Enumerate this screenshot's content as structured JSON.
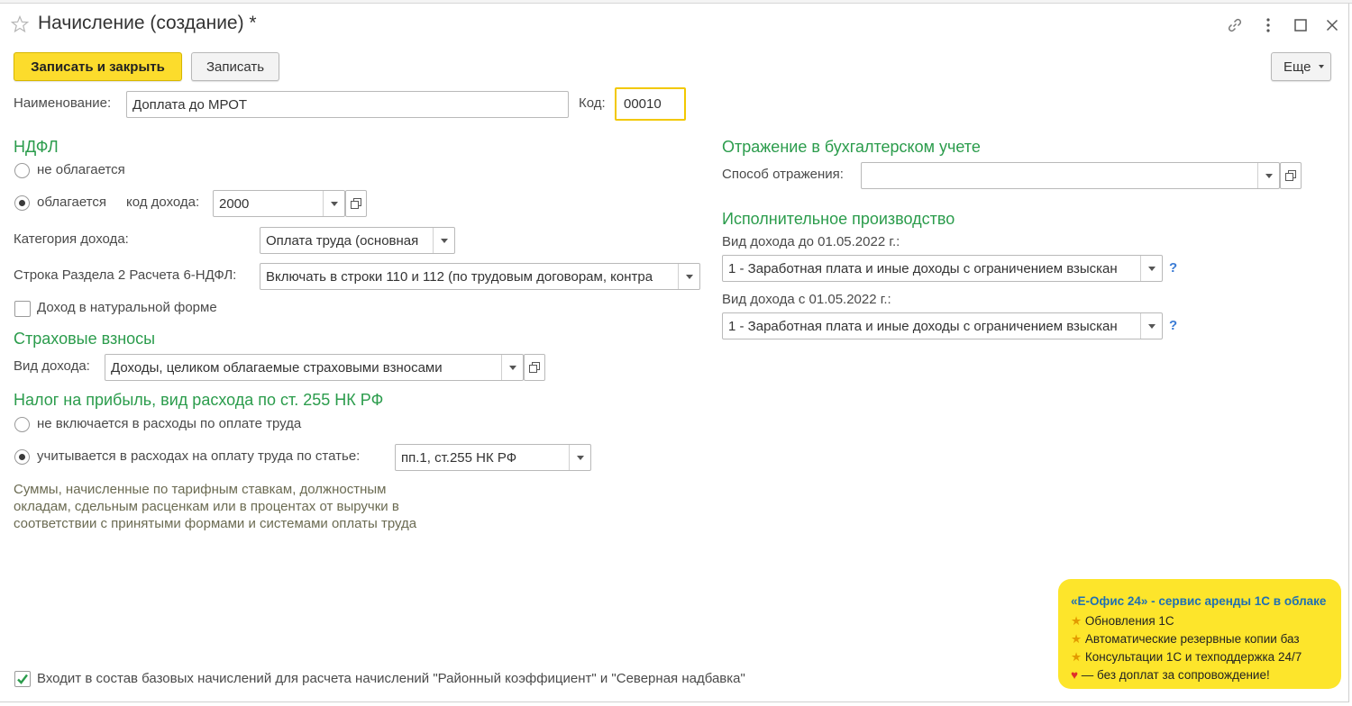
{
  "window": {
    "title": "Начисление (создание) *"
  },
  "toolbar": {
    "save_close_label": "Записать и закрыть",
    "save_label": "Записать",
    "more_label": "Еще"
  },
  "form": {
    "name_label": "Наименование:",
    "name_value": "Доплата до МРОТ",
    "code_label": "Код:",
    "code_value": "00010"
  },
  "ndfl": {
    "title": "НДФЛ",
    "not_taxed_label": "не облагается",
    "taxed_label": "облагается",
    "selected": "taxed",
    "income_code_label": "код дохода:",
    "income_code_value": "2000",
    "income_category_label": "Категория дохода:",
    "income_category_value": "Оплата труда (основная",
    "section2_label": "Строка Раздела 2 Расчета 6-НДФЛ:",
    "section2_value": "Включать в строки 110 и 112 (по трудовым договорам, контра",
    "natural_form_label": "Доход в натуральной форме",
    "natural_form_checked": false
  },
  "insurance": {
    "title": "Страховые взносы",
    "income_type_label": "Вид дохода:",
    "income_type_value": "Доходы, целиком облагаемые страховыми взносами"
  },
  "profit_tax": {
    "title": "Налог на прибыль, вид расхода по ст. 255 НК РФ",
    "not_included_label": "не включается в расходы по оплате труда",
    "included_label": "учитывается в расходах на оплату труда по статье:",
    "selected": "included",
    "article_value": "пп.1, ст.255 НК РФ",
    "hint_line1": "Суммы, начисленные по тарифным ставкам, должностным",
    "hint_line2": "окладам, сдельным расценкам или в процентах от выручки в",
    "hint_line3": "соответствии с принятыми формами и системами оплаты труда"
  },
  "accounting": {
    "title": "Отражение в бухгалтерском учете",
    "method_label": "Способ отражения:",
    "method_value": ""
  },
  "enforcement": {
    "title": "Исполнительное производство",
    "before_label": "Вид дохода до 01.05.2022 г.:",
    "before_value": "1 - Заработная плата и иные доходы с ограничением взыскан",
    "after_label": "Вид дохода с 01.05.2022 г.:",
    "after_value": "1 - Заработная плата и иные доходы с ограничением взыскан",
    "help_mark": "?"
  },
  "base_accruals": {
    "label": "Входит в состав базовых начислений для расчета начислений \"Районный коэффициент\" и \"Северная надбавка\"",
    "checked": true
  },
  "promo": {
    "headline": "«Е-Офис 24» - сервис аренды 1С в облаке",
    "item1": "Обновления 1С",
    "item2": "Автоматические резервные копии баз",
    "item3": "Консультации 1С и техподдержка 24/7",
    "item4": "— без доплат за сопровождение!"
  },
  "colors": {
    "accent_green": "#2b9c4c",
    "primary_yellow": "#fcdc2c",
    "code_focus": "#f2c800",
    "promo_bg": "#fde52b"
  },
  "icons": {
    "favorite": "star-icon",
    "link": "link-icon",
    "menu": "kebab-icon",
    "maximize": "maximize-icon",
    "close": "close-icon"
  }
}
